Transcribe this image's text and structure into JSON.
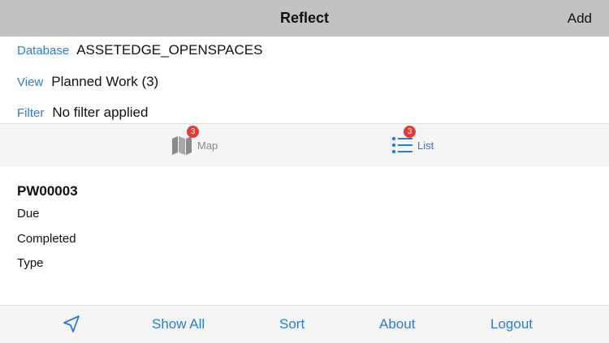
{
  "navbar": {
    "title": "Reflect",
    "add_label": "Add"
  },
  "info": {
    "database_label": "Database",
    "database_value": "ASSETEDGE_OPENSPACES",
    "view_label": "View",
    "view_value": "Planned Work (3)",
    "filter_label": "Filter",
    "filter_value": "No filter applied"
  },
  "segments": {
    "map": {
      "label": "Map",
      "badge": "3",
      "icon": "map-icon"
    },
    "list": {
      "label": "List",
      "badge": "3",
      "icon": "list-icon"
    }
  },
  "record": {
    "id": "PW00003",
    "fields": [
      "Due",
      "Completed",
      "Type"
    ]
  },
  "toolbar": {
    "location_icon": "location-arrow-icon",
    "show_all": "Show All",
    "sort": "Sort",
    "about": "About",
    "logout": "Logout"
  },
  "colors": {
    "accent": "#2a7cd6",
    "navbar": "#c2c2c2",
    "badge": "#e53935"
  }
}
